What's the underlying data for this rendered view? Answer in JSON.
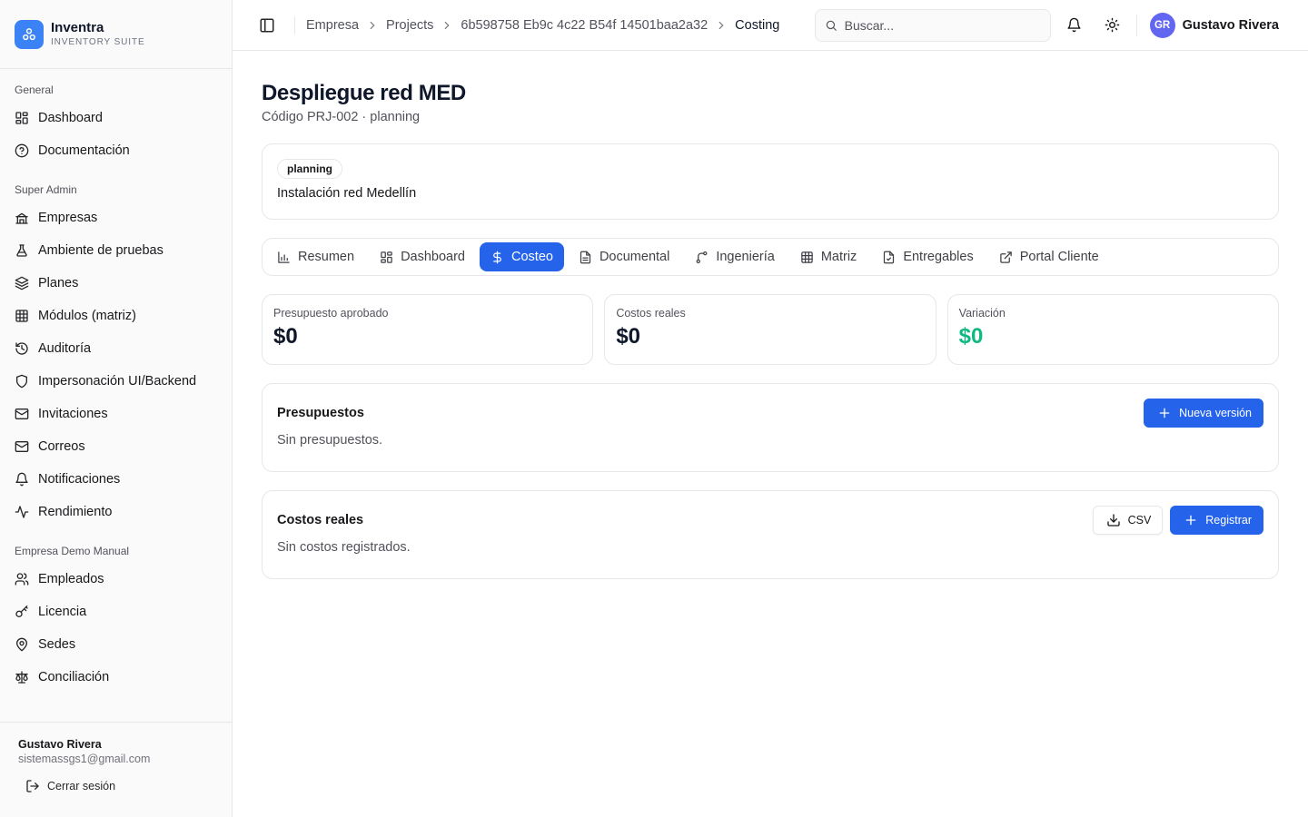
{
  "brand": {
    "name": "Inventra",
    "subtitle": "INVENTORY SUITE"
  },
  "sidebar": {
    "groups": [
      {
        "title": "General",
        "items": [
          {
            "label": "Dashboard",
            "icon": "layout-grid-icon"
          },
          {
            "label": "Documentación",
            "icon": "help-circle-icon"
          }
        ]
      },
      {
        "title": "Super Admin",
        "items": [
          {
            "label": "Empresas",
            "icon": "building-icon"
          },
          {
            "label": "Ambiente de pruebas",
            "icon": "flask-icon"
          },
          {
            "label": "Planes",
            "icon": "layers-icon"
          },
          {
            "label": "Módulos (matriz)",
            "icon": "table-icon"
          },
          {
            "label": "Auditoría",
            "icon": "history-icon"
          },
          {
            "label": "Impersonación UI/Backend",
            "icon": "shield-icon"
          },
          {
            "label": "Invitaciones",
            "icon": "mail-icon"
          },
          {
            "label": "Correos",
            "icon": "mail-icon"
          },
          {
            "label": "Notificaciones",
            "icon": "bell-icon"
          },
          {
            "label": "Rendimiento",
            "icon": "activity-icon"
          }
        ]
      },
      {
        "title": "Empresa Demo Manual",
        "items": [
          {
            "label": "Empleados",
            "icon": "users-icon"
          },
          {
            "label": "Licencia",
            "icon": "key-icon"
          },
          {
            "label": "Sedes",
            "icon": "map-pin-icon"
          },
          {
            "label": "Conciliación",
            "icon": "scale-icon"
          }
        ]
      }
    ]
  },
  "footer": {
    "user_name": "Gustavo Rivera",
    "user_email": "sistemassgs1@gmail.com",
    "logout_label": "Cerrar sesión"
  },
  "topbar": {
    "breadcrumb": [
      "Empresa",
      "Projects",
      "6b598758 Eb9c 4c22 B54f 14501baa2a32",
      "Costing"
    ],
    "search_placeholder": "Buscar...",
    "avatar_initials": "GR",
    "user_name": "Gustavo Rivera"
  },
  "page": {
    "title": "Despliegue red MED",
    "subtitle": "Código PRJ-002 · planning",
    "badge": "planning",
    "description": "Instalación red Medellín"
  },
  "tabs": [
    {
      "label": "Resumen",
      "icon": "bar-chart-icon",
      "active": false
    },
    {
      "label": "Dashboard",
      "icon": "layout-grid-icon",
      "active": false
    },
    {
      "label": "Costeo",
      "icon": "dollar-icon",
      "active": true
    },
    {
      "label": "Documental",
      "icon": "file-text-icon",
      "active": false
    },
    {
      "label": "Ingeniería",
      "icon": "git-branch-icon",
      "active": false
    },
    {
      "label": "Matriz",
      "icon": "table-icon",
      "active": false
    },
    {
      "label": "Entregables",
      "icon": "file-check-icon",
      "active": false
    },
    {
      "label": "Portal Cliente",
      "icon": "external-link-icon",
      "active": false
    }
  ],
  "stats": [
    {
      "label": "Presupuesto aprobado",
      "value": "$0"
    },
    {
      "label": "Costos reales",
      "value": "$0"
    },
    {
      "label": "Variación",
      "value": "$0"
    }
  ],
  "colors": {
    "primary": "#2563eb",
    "positive": "#10b981",
    "avatar": "#6366f1"
  },
  "budgets": {
    "title": "Presupuestos",
    "button": "Nueva versión",
    "empty": "Sin presupuestos."
  },
  "costs": {
    "title": "Costos reales",
    "csv_button": "CSV",
    "register_button": "Registrar",
    "empty": "Sin costos registrados."
  }
}
